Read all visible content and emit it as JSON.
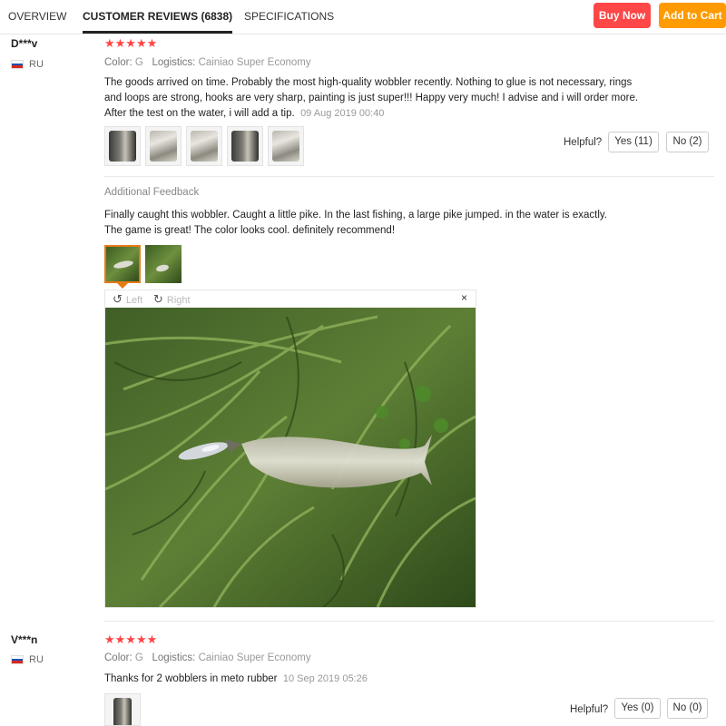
{
  "tabs": [
    {
      "label": "OVERVIEW"
    },
    {
      "label": "CUSTOMER REVIEWS (6838)"
    },
    {
      "label": "SPECIFICATIONS"
    }
  ],
  "actions": {
    "buy_now": "Buy Now",
    "add_to_cart": "Add to Cart"
  },
  "colors": {
    "buy_now": "#ff4747",
    "add_to_cart": "#ff9a00",
    "stars": "#ff4444",
    "selected_thumb": "#e57a17"
  },
  "reviews": [
    {
      "name": "D***v",
      "country": "RU",
      "stars": "★★★★★",
      "rating": 5,
      "color_label": "Color:",
      "color_value": "G",
      "logistics_label": "Logistics:",
      "logistics_value": "Cainiao Super Economy",
      "text_lines": [
        "The goods arrived on time. Probably the most high-quality wobbler recently. Nothing to glue is not necessary, rings",
        "and loops are strong, hooks are very sharp, painting is just super!!! Happy very much! I advise and i will order more.",
        "After the test on the water, i will add a tip."
      ],
      "date": "09 Aug 2019 00:40",
      "helpful": "Helpful?",
      "yes": "Yes (11)",
      "no": "No (2)",
      "additional": {
        "label": "Additional Feedback",
        "text_lines": [
          "Finally caught this wobbler. Caught a little pike. In the last fishing, a large pike jumped. in the water is exactly.",
          "The game is great! The color looks cool. definitely recommend!"
        ]
      },
      "viewer": {
        "left": "Left",
        "right": "Right",
        "close": "×"
      }
    },
    {
      "name": "V***n",
      "country": "RU",
      "stars": "★★★★★",
      "rating": 5,
      "color_label": "Color:",
      "color_value": "G",
      "logistics_label": "Logistics:",
      "logistics_value": "Cainiao Super Economy",
      "text": "Thanks for 2 wobblers in meto rubber",
      "date": "10 Sep 2019 05:26",
      "helpful": "Helpful?",
      "yes": "Yes (0)",
      "no": "No (0)"
    }
  ]
}
